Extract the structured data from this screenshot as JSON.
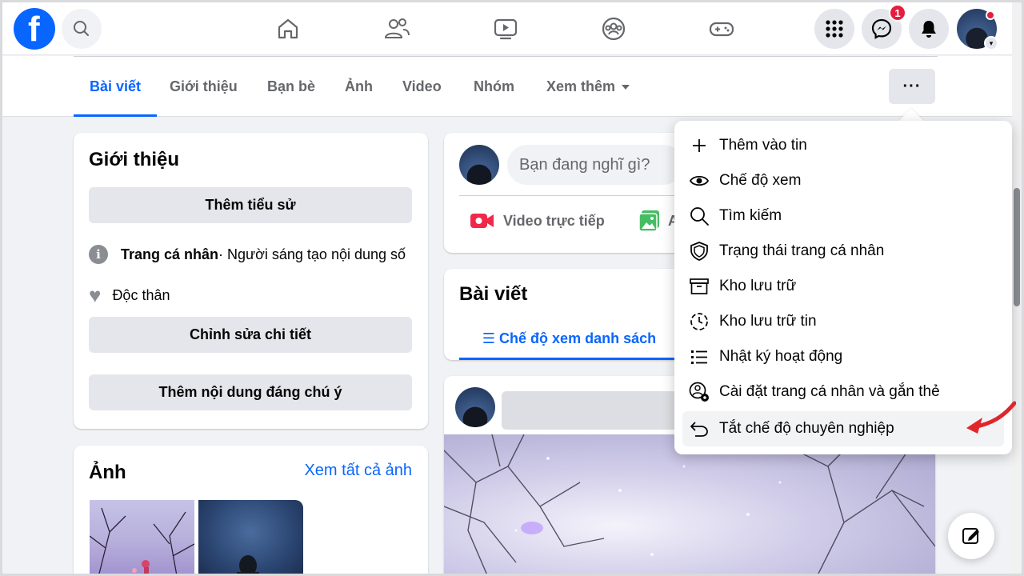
{
  "topbar": {
    "logo_letter": "f",
    "messenger_badge": "1"
  },
  "tabs": [
    {
      "label": "Bài viết",
      "active": true
    },
    {
      "label": "Giới thiệu"
    },
    {
      "label": "Bạn bè"
    },
    {
      "label": "Ảnh"
    },
    {
      "label": "Video"
    },
    {
      "label": "Nhóm"
    },
    {
      "label": "Xem thêm"
    }
  ],
  "more_button_label": "···",
  "intro": {
    "title": "Giới thiệu",
    "add_bio": "Thêm tiểu sử",
    "profile_label": "Trang cá nhân",
    "profile_desc": " · Người sáng tạo nội dung số",
    "relationship": "Độc thân",
    "edit_details": "Chỉnh sửa chi tiết",
    "add_featured": "Thêm nội dung đáng chú ý"
  },
  "photos": {
    "title": "Ảnh",
    "see_all": "Xem tất cả ảnh"
  },
  "composer": {
    "placeholder": "Bạn đang nghĩ gì?",
    "live_video": "Video trực tiếp",
    "photo_truncated": "A"
  },
  "posts": {
    "title": "Bài viết",
    "list_view": "☰ Chế độ xem danh sách"
  },
  "menu": {
    "items": [
      {
        "label": "Thêm vào tin",
        "icon": "plus-icon"
      },
      {
        "label": "Chế độ xem",
        "icon": "eye-icon"
      },
      {
        "label": "Tìm kiếm",
        "icon": "search-icon"
      },
      {
        "label": "Trạng thái trang cá nhân",
        "icon": "shield-icon"
      },
      {
        "label": "Kho lưu trữ",
        "icon": "archive-icon"
      },
      {
        "label": "Kho lưu trữ tin",
        "icon": "story-archive-icon"
      },
      {
        "label": "Nhật ký hoạt động",
        "icon": "activity-list-icon"
      },
      {
        "label": "Cài đặt trang cá nhân và gắn thẻ",
        "icon": "profile-settings-icon"
      },
      {
        "label": "Tắt chế độ chuyên nghiệp",
        "icon": "undo-icon",
        "highlighted": true
      }
    ]
  },
  "colors": {
    "brand_blue": "#0866ff",
    "badge_red": "#e41e3f",
    "annotation_red": "#e0262b"
  }
}
